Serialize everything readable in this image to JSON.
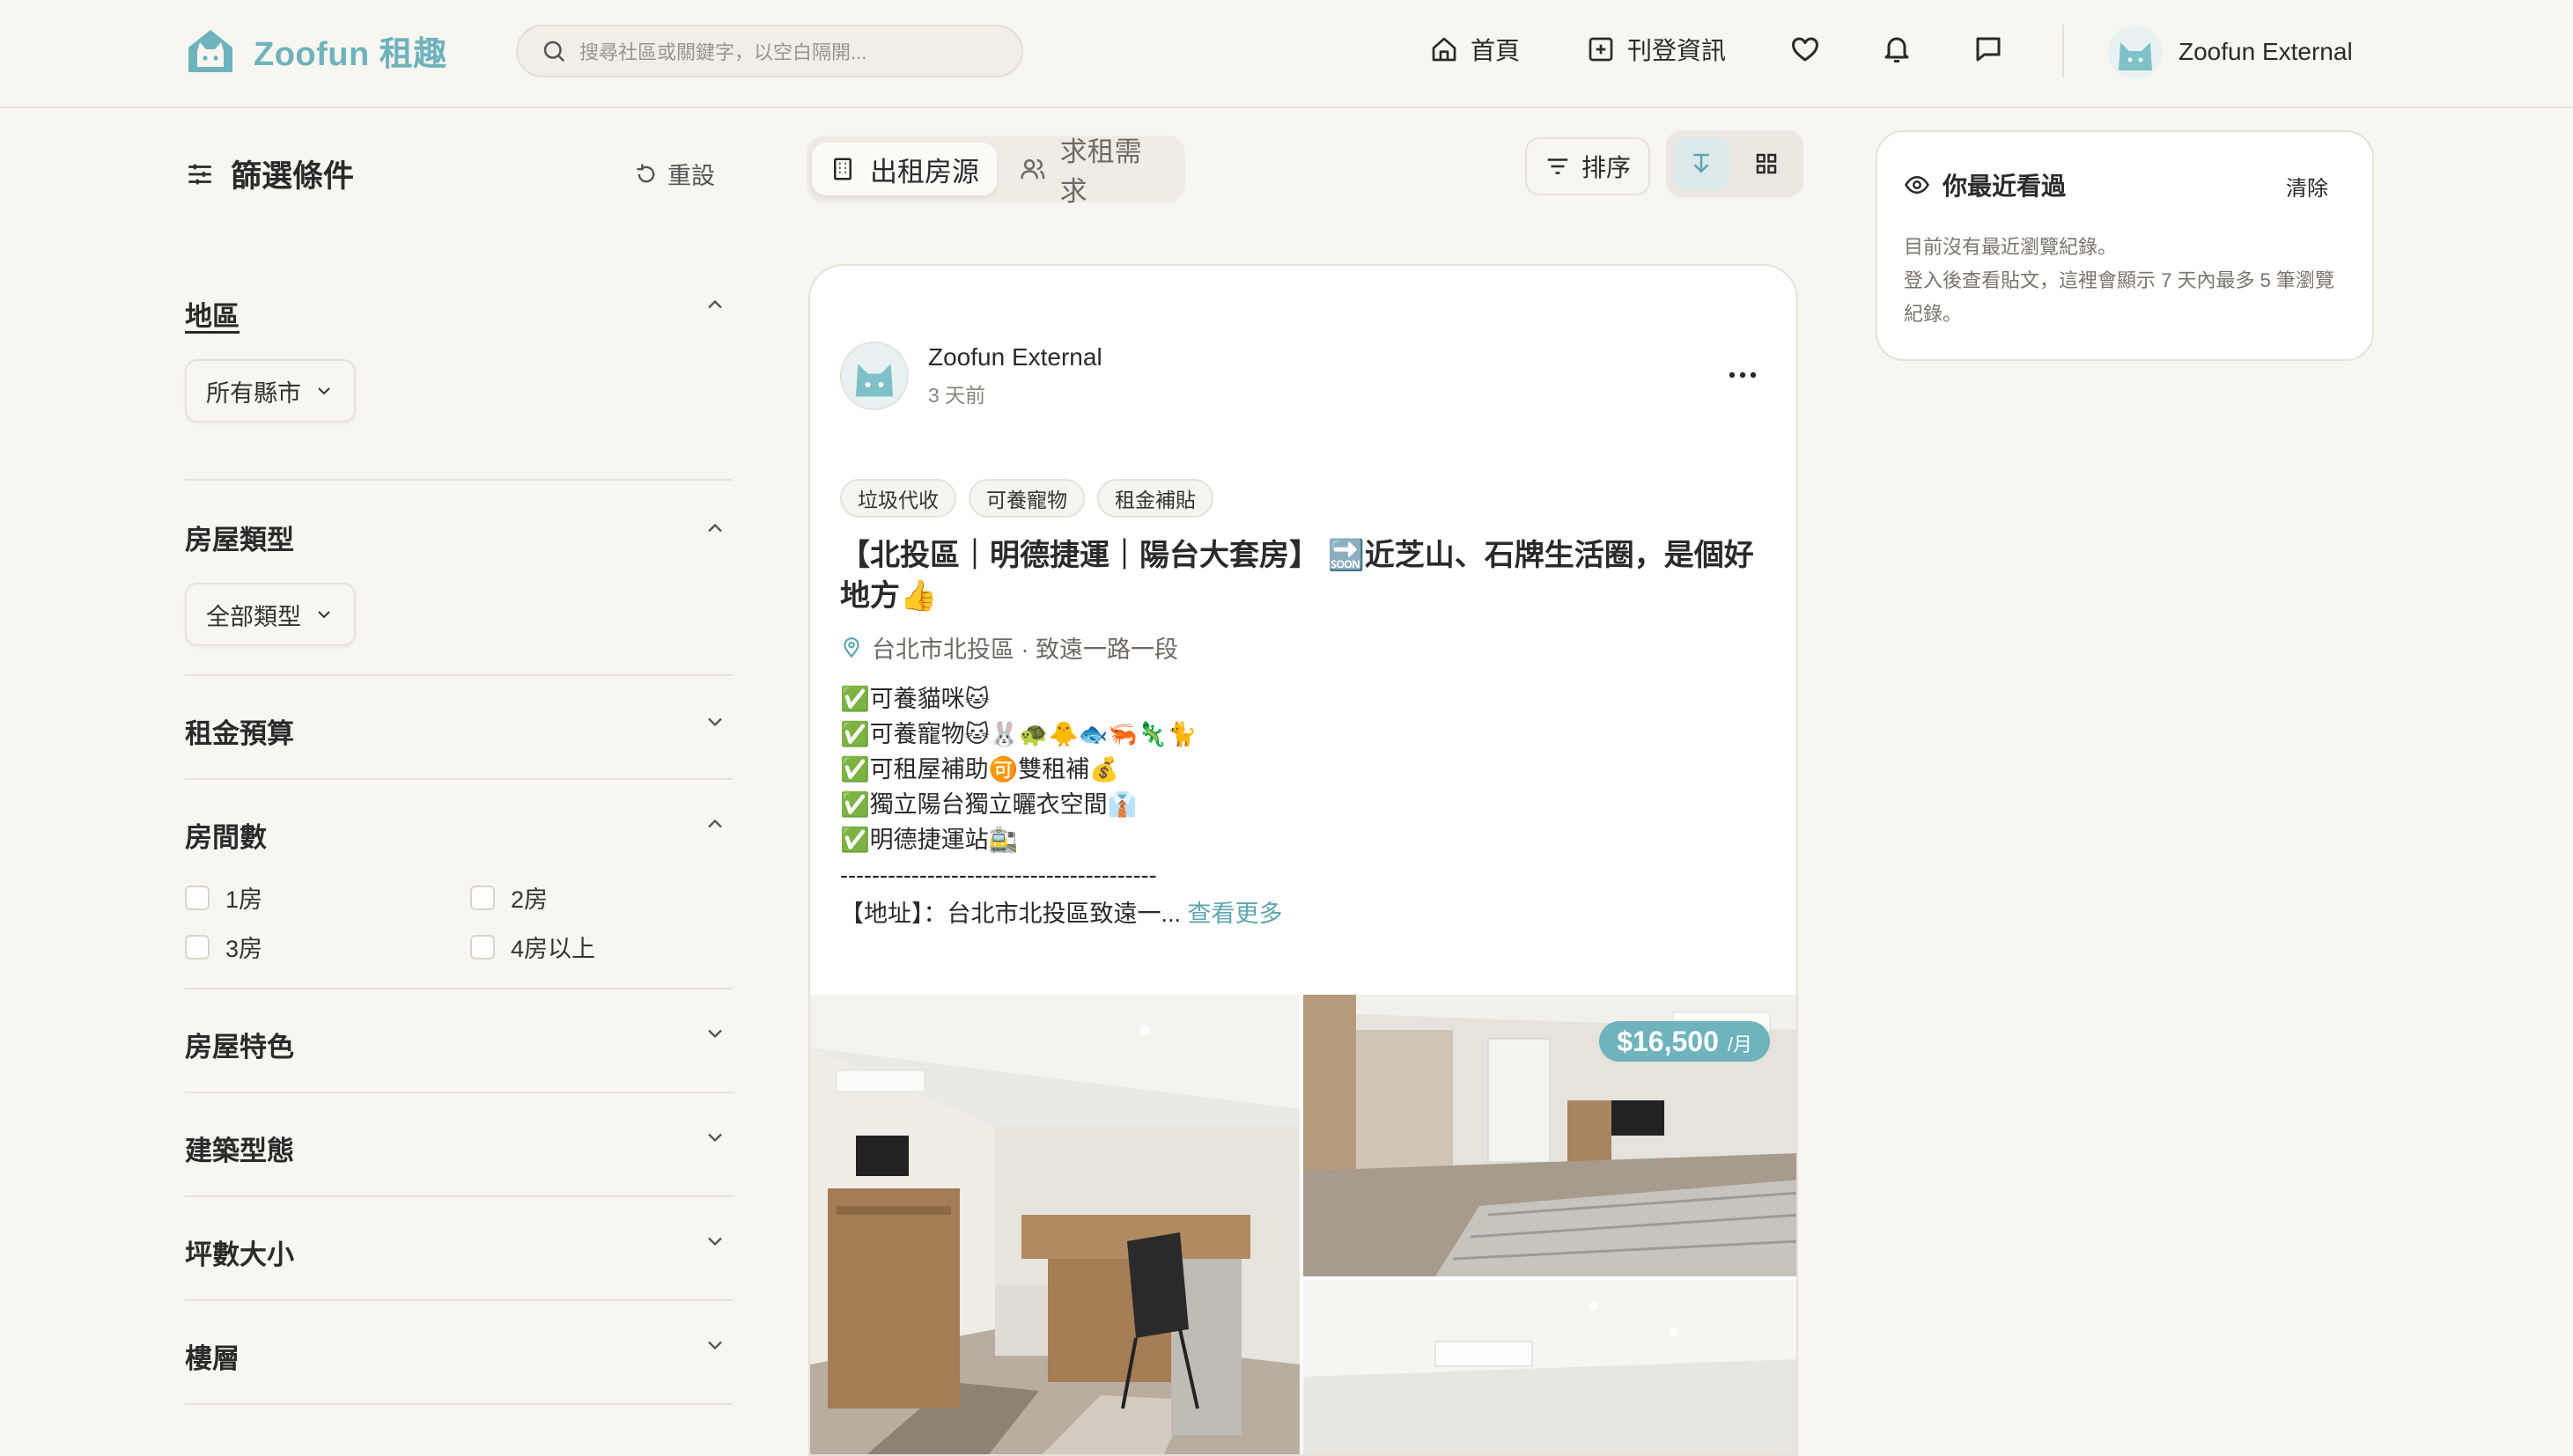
{
  "header": {
    "brand": "Zoofun 租趣",
    "search_placeholder": "搜尋社區或關鍵字，以空白隔開...",
    "nav": {
      "home": "首頁",
      "post": "刊登資訊"
    },
    "user_name": "Zoofun External"
  },
  "colors": {
    "accent": "#6fb3bc",
    "background": "#f8f6f1"
  },
  "filters": {
    "title": "篩選條件",
    "reset": "重設",
    "region": {
      "title": "地區",
      "value": "所有縣市"
    },
    "house_type": {
      "title": "房屋類型",
      "value": "全部類型"
    },
    "budget": {
      "title": "租金預算"
    },
    "rooms": {
      "title": "房間數",
      "options": [
        "1房",
        "2房",
        "3房",
        "4房以上"
      ]
    },
    "features": {
      "title": "房屋特色"
    },
    "building": {
      "title": "建築型態"
    },
    "size": {
      "title": "坪數大小"
    },
    "floor": {
      "title": "樓層"
    }
  },
  "tabs": {
    "rent_supply": "出租房源",
    "rent_demand": "求租需求"
  },
  "toolbar": {
    "sort": "排序"
  },
  "post": {
    "author": "Zoofun External",
    "time": "3 天前",
    "tags": [
      "垃圾代收",
      "可養寵物",
      "租金補貼"
    ],
    "title": "【北投區｜明德捷運｜陽台大套房】 🔜近芝山、石牌生活圈，是個好地方👍",
    "location": "台北市北投區 · 致遠一路一段",
    "body_lines": [
      "✅可養貓咪🐱",
      "✅可養寵物🐱🐰🐢🐥🐟🦐🦎🐈",
      "✅可租屋補助🉑雙租補💰",
      "✅獨立陽台獨立曬衣空間👔",
      "✅明德捷運站🚉",
      "----------------------------------------"
    ],
    "address_text": "【地址】：台北市北投區致遠一...",
    "see_more": "查看更多",
    "price": "$16,500",
    "price_unit": "/月"
  },
  "recent": {
    "title": "你最近看過",
    "clear": "清除",
    "line1": "目前沒有最近瀏覽紀錄。",
    "line2": "登入後查看貼文，這裡會顯示 7 天內最多 5 筆瀏覽紀錄。"
  }
}
